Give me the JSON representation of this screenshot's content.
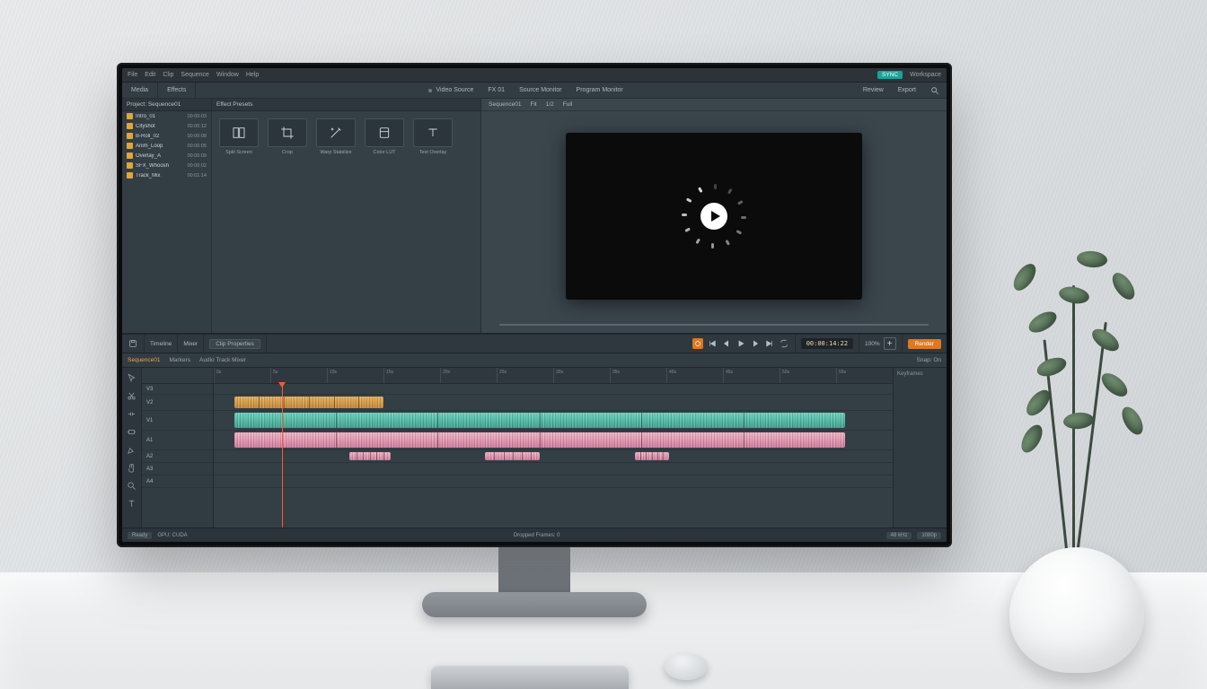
{
  "menubar": {
    "items": [
      "File",
      "Edit",
      "Clip",
      "Sequence",
      "Window",
      "Help"
    ],
    "right": "Workspace",
    "badge": "SYNC"
  },
  "topbar": {
    "left_tabs": [
      "Media",
      "Effects"
    ],
    "right_tabs": [
      "Video Source",
      "FX 01",
      "Source Monitor",
      "Program Monitor"
    ],
    "far_right": [
      "Review",
      "Export"
    ]
  },
  "project": {
    "header": "Project: Sequence01",
    "files": [
      {
        "name": "Intro_01",
        "tc": "00:00:03"
      },
      {
        "name": "Cityshot",
        "tc": "00:00:12"
      },
      {
        "name": "B-Roll_02",
        "tc": "00:00:08"
      },
      {
        "name": "Anim_Loop",
        "tc": "00:00:05"
      },
      {
        "name": "Overlay_A",
        "tc": "00:00:09"
      },
      {
        "name": "SFX_Whoosh",
        "tc": "00:00:02"
      },
      {
        "name": "Track_Mix",
        "tc": "00:01:14"
      }
    ]
  },
  "effects": {
    "header": "Effect Presets",
    "items": [
      {
        "label": "Split Screen",
        "icon": "split"
      },
      {
        "label": "Crop",
        "icon": "crop"
      },
      {
        "label": "Warp Stabilize",
        "icon": "wand"
      },
      {
        "label": "Color LUT",
        "icon": "swatch"
      },
      {
        "label": "Text Overlay",
        "icon": "text"
      }
    ]
  },
  "preview": {
    "menu": [
      "Sequence01",
      "Fit",
      "1/2",
      "Full"
    ]
  },
  "midbar": {
    "left_tabs": [
      "Timeline",
      "Mixer",
      "Clip Properties"
    ],
    "timecode": "00:00:14:22",
    "transport": [
      "Begin",
      "Prev",
      "Play",
      "Next",
      "End",
      "Loop"
    ],
    "zoom": "100%",
    "render": "Render"
  },
  "tlbar2": {
    "tabs": [
      "Sequence01",
      "Markers",
      "Audio Track Mixer"
    ],
    "right": "Snap: On"
  },
  "timeline": {
    "tracks": [
      {
        "name": "V3",
        "h": 12
      },
      {
        "name": "V2",
        "h": 18
      },
      {
        "name": "V1",
        "h": 22
      },
      {
        "name": "A1",
        "h": 22
      },
      {
        "name": "A2",
        "h": 14
      },
      {
        "name": "A3",
        "h": 14
      },
      {
        "name": "A4",
        "h": 14
      }
    ],
    "ruler_seconds": [
      0,
      5,
      10,
      15,
      20,
      25,
      30,
      35,
      40,
      45,
      50,
      55,
      60
    ],
    "right_panel": "Keyframes"
  },
  "status": {
    "left": [
      "Ready",
      "GPU: CUDA"
    ],
    "center": "Dropped Frames: 0",
    "right": [
      "48 kHz",
      "1080p"
    ]
  }
}
